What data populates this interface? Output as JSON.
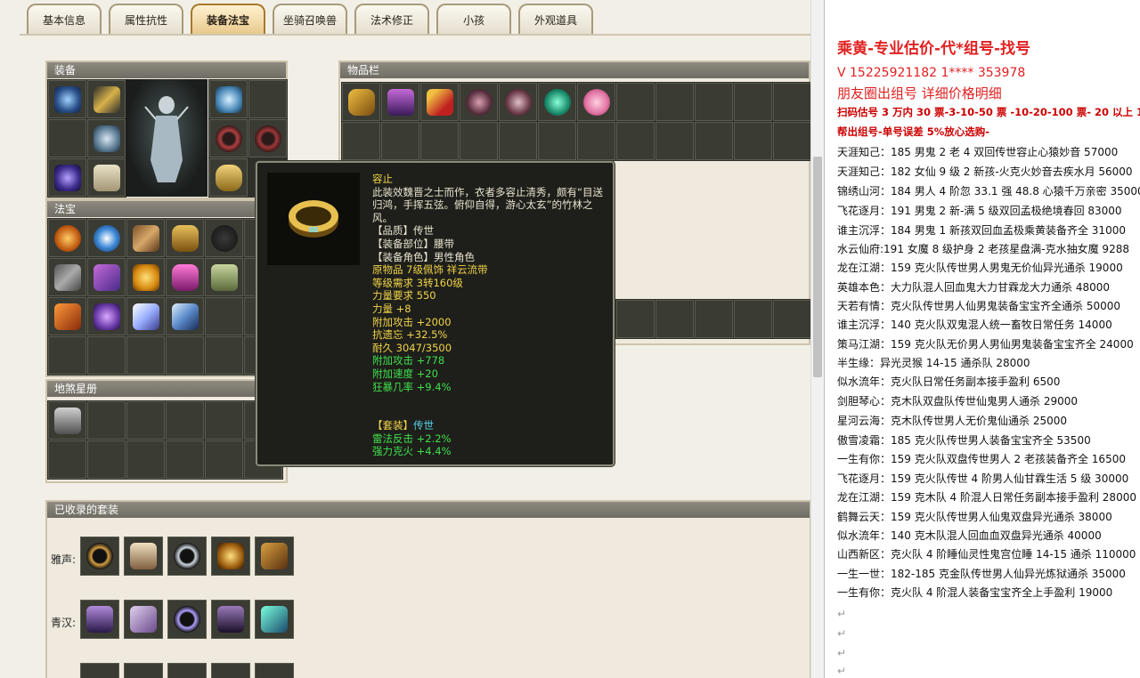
{
  "tabs": [
    {
      "label": "基本信息"
    },
    {
      "label": "属性抗性"
    },
    {
      "label": "装备法宝",
      "active": true
    },
    {
      "label": "坐骑召唤兽"
    },
    {
      "label": "法术修正"
    },
    {
      "label": "小孩"
    },
    {
      "label": "外观道具"
    }
  ],
  "panels": {
    "equipment": "装备",
    "inventory": "物品栏",
    "fabao": "法宝",
    "dishaxing": "地煞星册",
    "collected_sets": "已收录的套装"
  },
  "sets": [
    {
      "label": "雅声:"
    },
    {
      "label": "青汉:"
    }
  ],
  "tooltip": {
    "name": "容止",
    "description": "此装效魏晋之士而作，衣者多容止清秀，颇有“目送归鸿，手挥五弦。俯仰自得，游心太玄”的竹林之风。",
    "quality": "【品质】传世",
    "slot": "【装备部位】腰带",
    "role": "【装备角色】男性角色",
    "origin": "原物品 7级佩饰 祥云流带",
    "level_req": "等级需求 3转160级",
    "str_req": "力量要求 550",
    "str": "力量 +8",
    "atk": "附加攻击 +2000",
    "forget_res": "抗遗忘 +32.5%",
    "durability": "耐久 3047/3500",
    "bonus_atk": "附加攻击 +778",
    "bonus_speed": "附加速度 +20",
    "crit": "狂暴几率 +9.4%",
    "set_label": "【套装】",
    "set_name": "传世",
    "set_bonus1": "雷法反击 +2.2%",
    "set_bonus2": "强力克火 +4.4%"
  },
  "doc": {
    "title": "乘黄-专业估价-代*组号-找号",
    "phone": "V 15225921182   1**** 353978",
    "subtitle": "朋友圈出组号    详细价格明细",
    "rate1": "扫码估号 3 万内 30 票-3-10-50 票  -10-20-100 票- 20 以上 150",
    "rate2": "帮出组号-单号误差 5%放心选购-",
    "listings": [
      "天涯知己：185 男鬼 2 老 4 双回传世容止心猿妙音 57000",
      "天涯知己：182 女仙 9 级 2 新孩-火克火妙音去疾水月 56000",
      "锦绣山河：184 男人 4 阶忽 33.1 强 48.8 心猿千万亲密 35000",
      "飞花逐月：191 男鬼 2 新-满 5 级双回孟极绝境春回 83000",
      "谁主沉浮：184 男鬼 1 新孩双回血孟极乘黄装备齐全 31000",
      "水云仙府:191 女魔 8 级护身 2 老孩星盘满-克水抽女魔 9288",
      "龙在江湖：159 克火队传世男人男鬼无价仙异光通杀 19000",
      "英雄本色：大力队混人回血鬼大力甘霖龙大力通杀 48000",
      "天若有情：克火队传世男人仙男鬼装备宝宝齐全通杀 50000",
      "谁主沉浮：140 克火队双鬼混人统一畜牧日常任务 14000",
      "策马江湖：159 克火队无价男人男仙男鬼装备宝宝齐全 24000",
      "半生缘：异光灵猴 14-15 通杀队 28000",
      "似水流年：克火队日常任务副本接手盈利 6500",
      "剑胆琴心：克木队双盘队传世仙鬼男人通杀 29000",
      "星河云海：克木队传世男人无价鬼仙通杀 25000",
      "傲雪凌霜：185 克火队传世男人装备宝宝齐全 53500",
      "一生有你：159 克火队双盘传世男人 2 老孩装备齐全 16500",
      "飞花逐月：159 克火队传世 4 阶男人仙甘霖生活 5 级 30000",
      "龙在江湖：159 克木队 4 阶混人日常任务副本接手盈利 28000",
      "鹤舞云天：159 克火队传世男人仙鬼双盘异光通杀 38000",
      "似水流年：140 克木队混人回血血双盘异光通杀 40000",
      "山西新区：克火队 4 阶睡仙灵性鬼宫位睡 14-15 通杀 110000",
      "一生一世：182-185 克金队传世男人仙异光炼狱通杀 35000",
      "一生有你：克火队 4 阶混人装备宝宝齐全上手盈利 19000"
    ]
  },
  "colors": {
    "title_red": "#e02020",
    "rate_red": "#cc0000",
    "tooltip_yellow": "#f2d44a",
    "tooltip_green": "#3fe04c",
    "tooltip_cyan": "#56d2e8"
  }
}
